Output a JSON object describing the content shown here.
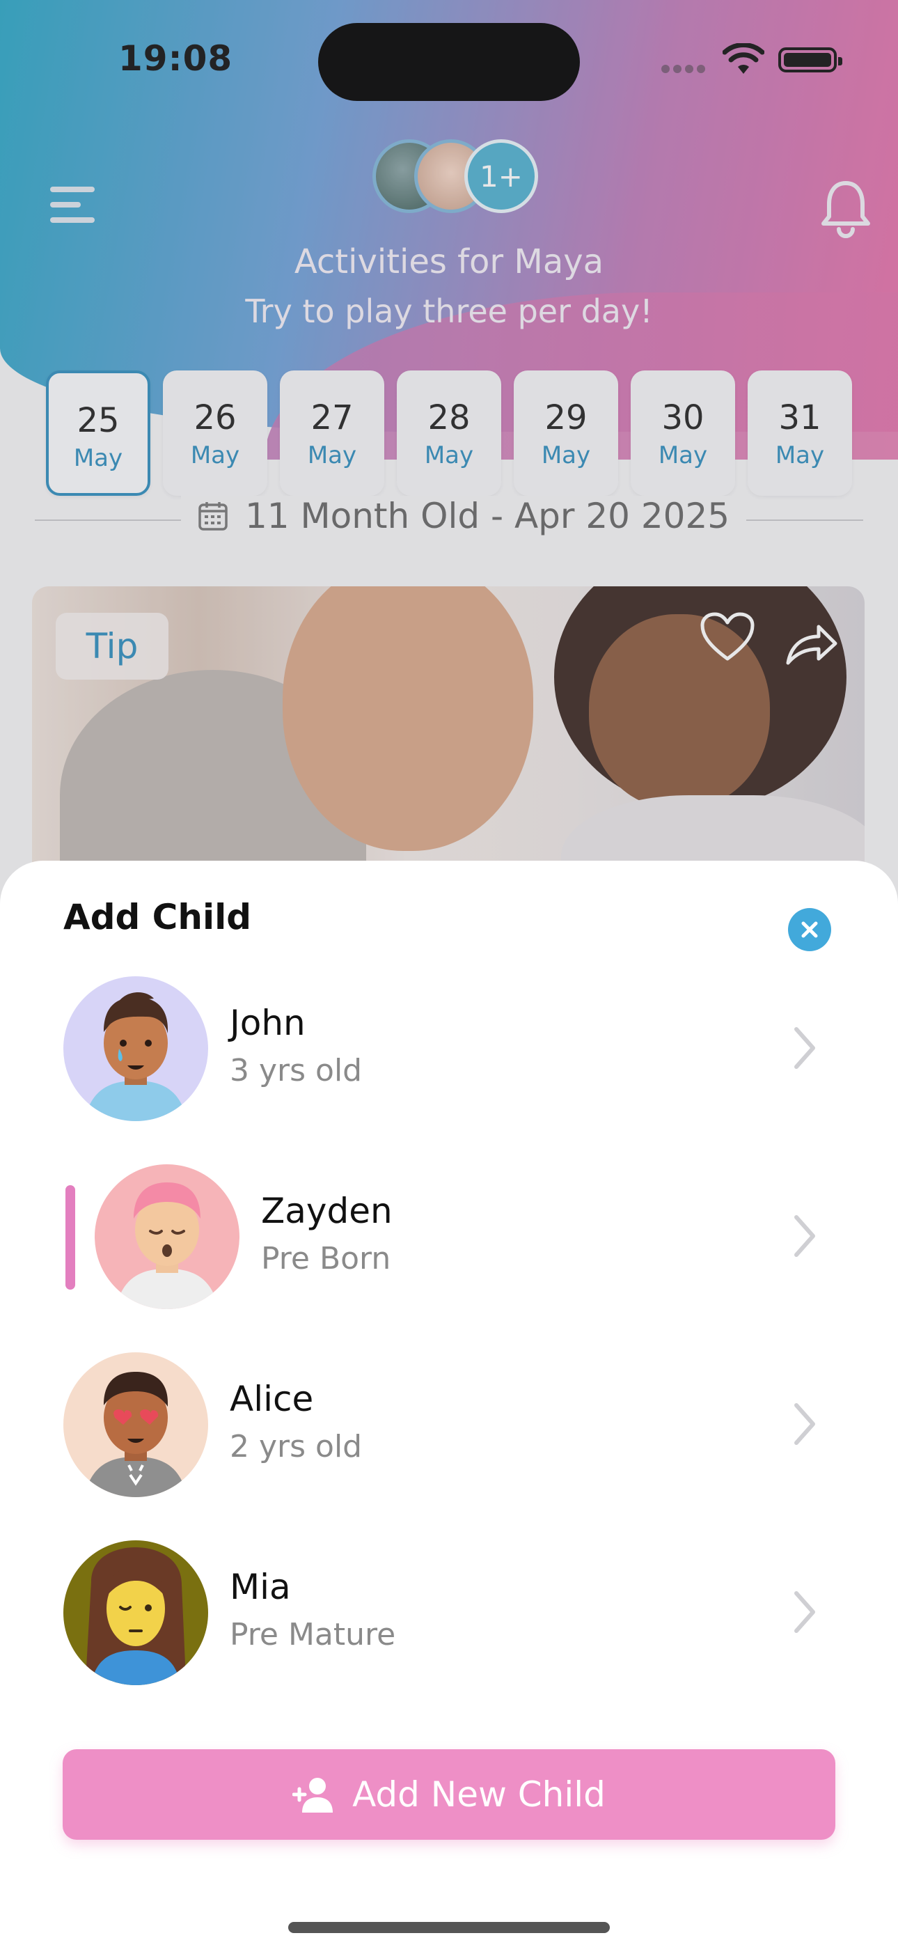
{
  "status_bar": {
    "time": "19:08"
  },
  "header": {
    "title": "Activities for Maya",
    "subtitle": "Try to play three per day!",
    "more_children_badge": "1+"
  },
  "dates": [
    {
      "day": "25",
      "month": "May",
      "selected": true
    },
    {
      "day": "26",
      "month": "May",
      "selected": false
    },
    {
      "day": "27",
      "month": "May",
      "selected": false
    },
    {
      "day": "28",
      "month": "May",
      "selected": false
    },
    {
      "day": "29",
      "month": "May",
      "selected": false
    },
    {
      "day": "30",
      "month": "May",
      "selected": false
    },
    {
      "day": "31",
      "month": "May",
      "selected": false
    }
  ],
  "age_label": "11 Month Old - Apr 20 2025",
  "tip_card": {
    "badge": "Tip"
  },
  "sheet": {
    "title": "Add Child",
    "children": [
      {
        "name": "John",
        "age": "3 yrs old",
        "selected": false
      },
      {
        "name": "Zayden",
        "age": "Pre Born",
        "selected": true
      },
      {
        "name": "Alice",
        "age": "2 yrs old",
        "selected": false
      },
      {
        "name": "Mia",
        "age": "Pre Mature",
        "selected": false
      }
    ],
    "add_button_label": "Add New Child"
  },
  "colors": {
    "accent_blue": "#2e8dbd",
    "close_button": "#42a9db",
    "add_button": "#ee8fc6",
    "selected_indicator": "#e37fbf"
  },
  "icons": [
    "menu-icon",
    "bell-icon",
    "calendar-icon",
    "heart-icon",
    "share-icon",
    "close-icon",
    "chevron-right-icon",
    "add-user-icon"
  ]
}
